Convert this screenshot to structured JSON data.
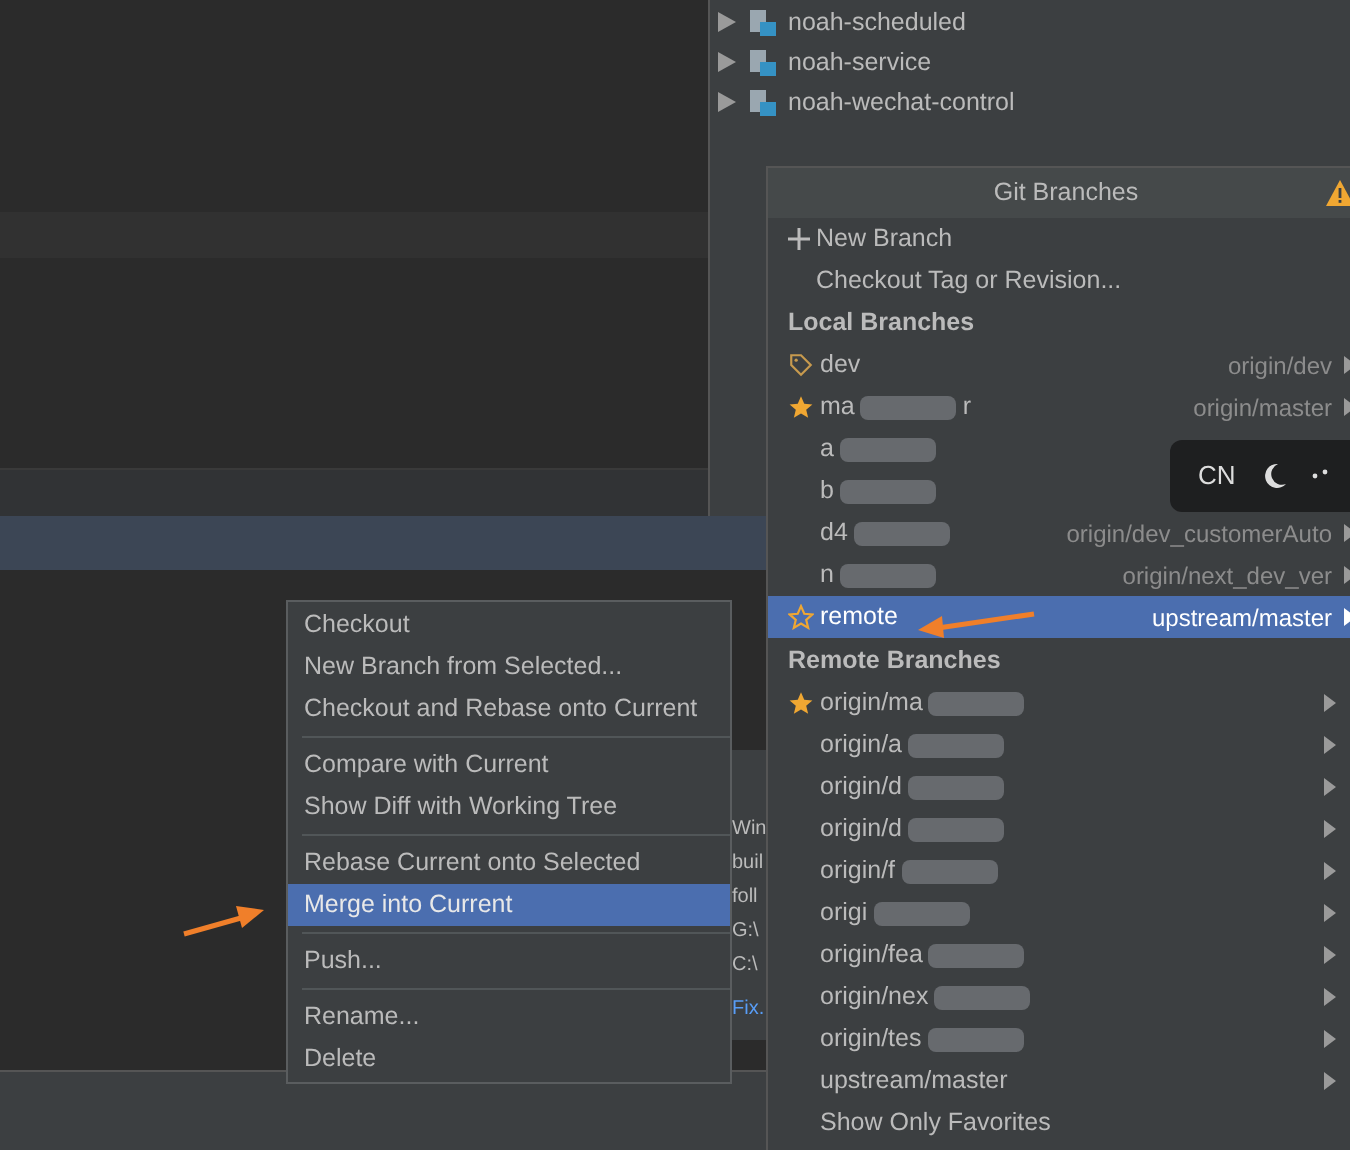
{
  "project_tree": {
    "items": [
      {
        "label": "noah-scheduled",
        "expanded": false
      },
      {
        "label": "noah-service",
        "expanded": false
      },
      {
        "label": "noah-wechat-control",
        "expanded": false
      }
    ]
  },
  "behind_panel": {
    "lines": [
      {
        "text": "Win",
        "kind": "text"
      },
      {
        "text": "buil",
        "kind": "text"
      },
      {
        "text": "foll",
        "kind": "text"
      },
      {
        "text": "G:\\",
        "kind": "text"
      },
      {
        "text": "C:\\",
        "kind": "text"
      },
      {
        "text": "Fix.",
        "kind": "link"
      }
    ]
  },
  "context_menu": {
    "groups": [
      [
        {
          "label": "Checkout",
          "selected": false
        },
        {
          "label": "New Branch from Selected...",
          "selected": false
        },
        {
          "label": "Checkout and Rebase onto Current",
          "selected": false
        }
      ],
      [
        {
          "label": "Compare with Current",
          "selected": false
        },
        {
          "label": "Show Diff with Working Tree",
          "selected": false
        }
      ],
      [
        {
          "label": "Rebase Current onto Selected",
          "selected": false
        },
        {
          "label": "Merge into Current",
          "selected": true
        }
      ],
      [
        {
          "label": "Push...",
          "selected": false
        }
      ],
      [
        {
          "label": "Rename...",
          "selected": false
        },
        {
          "label": "Delete",
          "selected": false
        }
      ]
    ]
  },
  "git_branches": {
    "title": "Git Branches",
    "actions": [
      {
        "label": "New Branch",
        "kind": "new"
      },
      {
        "label": "Checkout Tag or Revision...",
        "kind": "plain"
      }
    ],
    "local_heading": "Local Branches",
    "local": [
      {
        "name": "dev",
        "kind": "tag",
        "redacted": false,
        "tracking": "origin/dev",
        "selected": false
      },
      {
        "name": "ma",
        "kind": "star",
        "redacted": true,
        "tail": "r",
        "tracking": "origin/master",
        "selected": false
      },
      {
        "name": "a",
        "kind": "plain",
        "redacted": true,
        "selected": false
      },
      {
        "name": "b",
        "kind": "plain",
        "redacted": true,
        "selected": false
      },
      {
        "name": "d4",
        "kind": "plain",
        "redacted": true,
        "tracking": "origin/dev_customerAuto",
        "selected": false
      },
      {
        "name": "n",
        "kind": "plain",
        "redacted": true,
        "tracking": "origin/next_dev_ver",
        "selected": false
      },
      {
        "name": "remote",
        "kind": "star-outline",
        "redacted": false,
        "tracking": "upstream/master",
        "selected": true
      }
    ],
    "remote_heading": "Remote Branches",
    "remote": [
      {
        "name": "origin/ma",
        "kind": "star",
        "redacted": true
      },
      {
        "name": "origin/a",
        "kind": "plain",
        "redacted": true
      },
      {
        "name": "origin/d",
        "kind": "plain",
        "redacted": true
      },
      {
        "name": "origin/d",
        "kind": "plain",
        "redacted": true
      },
      {
        "name": "origin/f",
        "kind": "plain",
        "redacted": true
      },
      {
        "name": "origi",
        "kind": "plain",
        "redacted": true
      },
      {
        "name": "origin/fea",
        "kind": "plain",
        "redacted": true
      },
      {
        "name": "origin/nex",
        "kind": "plain",
        "redacted": true
      },
      {
        "name": "origin/tes",
        "kind": "plain",
        "redacted": true
      },
      {
        "name": "upstream/master",
        "kind": "plain",
        "redacted": false
      }
    ],
    "footer": "Show Only Favorites"
  },
  "ime_toolbar": {
    "label": "CN"
  }
}
